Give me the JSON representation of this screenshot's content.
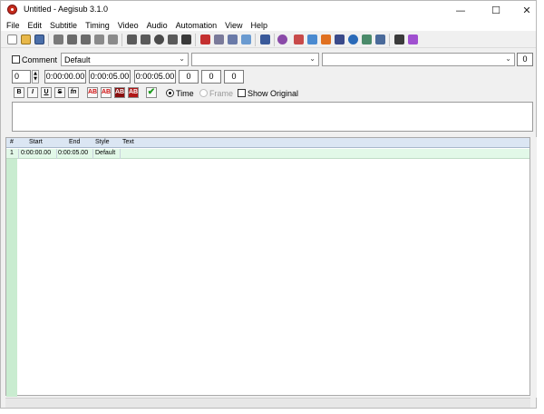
{
  "window": {
    "title": "Untitled - Aegisub 3.1.0"
  },
  "menu": [
    "File",
    "Edit",
    "Subtitle",
    "Timing",
    "Video",
    "Audio",
    "Automation",
    "View",
    "Help"
  ],
  "editor": {
    "comment_label": "Comment",
    "style_value": "Default",
    "actor_value": "",
    "effect_value": "",
    "layer_value": "0",
    "start_time": "0:00:00.00",
    "end_time": "0:00:05.00",
    "duration": "0:00:05.00",
    "margin_left": "0",
    "margin_right": "0",
    "margin_vertical": "0",
    "effect_number": "0",
    "format_buttons": [
      "B",
      "I",
      "U",
      "S",
      "fn",
      "AB",
      "AB",
      "AB",
      "AB"
    ],
    "time_label": "Time",
    "frame_label": "Frame",
    "show_original_label": "Show Original",
    "text_value": ""
  },
  "grid": {
    "headers": [
      "#",
      "Start",
      "End",
      "Style",
      "Text"
    ],
    "rows": [
      {
        "num": "1",
        "start": "0:00:00.00",
        "end": "0:00:05.00",
        "style": "Default",
        "text": ""
      }
    ]
  },
  "colors": {
    "accent_red": "#c42b1c",
    "grid_header": "#dbe6f3",
    "row_green": "#e2f8e8",
    "rownum_green": "#c9ecd0"
  }
}
